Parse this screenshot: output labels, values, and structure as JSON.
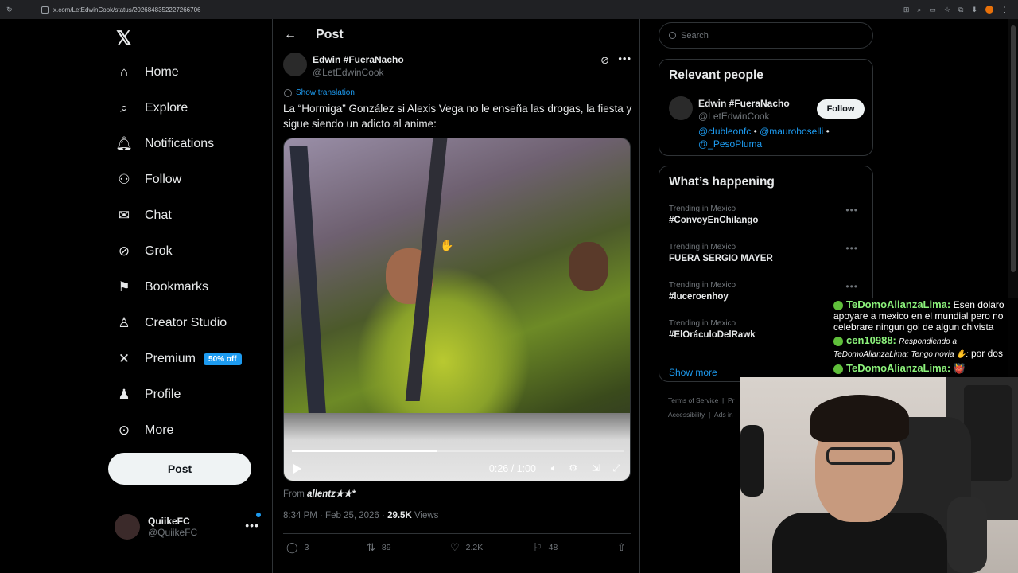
{
  "browser": {
    "url": "x.com/LetEdwinCook/status/2026848352227266706"
  },
  "nav": {
    "items": [
      {
        "label": "Home",
        "icon": "home-icon"
      },
      {
        "label": "Explore",
        "icon": "search-icon"
      },
      {
        "label": "Notifications",
        "icon": "bell-icon"
      },
      {
        "label": "Follow",
        "icon": "add-user-icon"
      },
      {
        "label": "Chat",
        "icon": "mail-icon"
      },
      {
        "label": "Grok",
        "icon": "grok-icon"
      },
      {
        "label": "Bookmarks",
        "icon": "bookmark-icon"
      },
      {
        "label": "Creator Studio",
        "icon": "creator-icon"
      },
      {
        "label": "Premium",
        "icon": "x-icon"
      },
      {
        "label": "Profile",
        "icon": "user-icon"
      },
      {
        "label": "More",
        "icon": "more-circle-icon"
      }
    ],
    "premium_badge": "50% off",
    "post_button": "Post",
    "me": {
      "name": "QuiikeFC",
      "handle": "@QuiikeFC"
    }
  },
  "main": {
    "header_title": "Post",
    "author": {
      "name": "Edwin #FueraNacho",
      "handle": "@LetEdwinCook"
    },
    "show_translation": "Show translation",
    "text": "La “Hormiga” González si Alexis Vega no le enseña las drogas, la fiesta y sigue siendo un adicto al anime:",
    "video": {
      "time": "0:26 / 1:00",
      "progress": 0.44
    },
    "from_label": "From",
    "from_source": "allentz★★*",
    "timestamp": "8:34 PM · Feb 25, 2026 ·",
    "views_count": "29.5K",
    "views_label": "Views",
    "actions": {
      "replies": "3",
      "reposts": "89",
      "likes": "2.2K",
      "bookmarks": "48"
    }
  },
  "sidebar": {
    "search_placeholder": "Search",
    "relevant_title": "Relevant people",
    "relevant_person": {
      "name": "Edwin #FueraNacho",
      "handle": "@LetEdwinCook",
      "follow_label": "Follow",
      "bio_link1": "@clubleonfc",
      "bio_link2": "@mauroboselli",
      "bio_link3": "@_PesoPluma"
    },
    "happening_title": "What’s happening",
    "trends": [
      {
        "context": "Trending in Mexico",
        "topic": "#ConvoyEnChilango"
      },
      {
        "context": "Trending in Mexico",
        "topic": "FUERA SERGIO MAYER"
      },
      {
        "context": "Trending in Mexico",
        "topic": "#luceroenhoy"
      },
      {
        "context": "Trending in Mexico",
        "topic": "#ElOráculoDelRawk"
      }
    ],
    "show_more": "Show more",
    "footer": {
      "terms": "Terms of Service",
      "privacy": "Pr",
      "accessibility": "Accessibility",
      "ads": "Ads in"
    }
  },
  "overlay": {
    "chat": [
      {
        "user": "TeDomoAlianzaLima:",
        "text": "Esen dolaro apoyare a mexico en el mundial pero no celebrare ningun gol de algun chivista"
      },
      {
        "user": "cen10988:",
        "reply": "Respondiendo a TeDomoAlianzaLima: Tengo novia ✋:",
        "text": "por dos"
      },
      {
        "user": "TeDomoAlianzaLima:",
        "text": "👹"
      }
    ]
  }
}
